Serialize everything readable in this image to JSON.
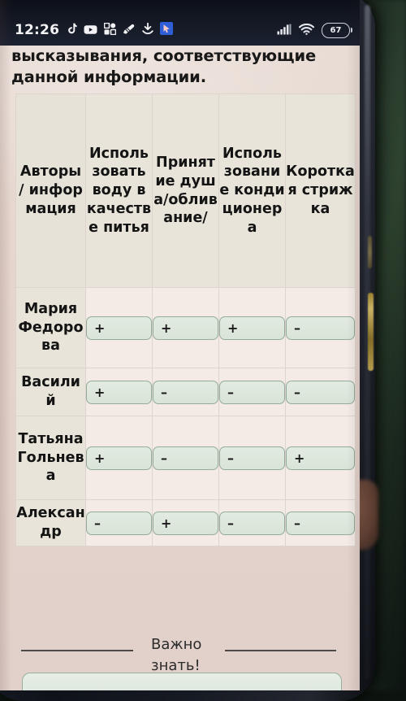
{
  "status_bar": {
    "time": "12:26",
    "left_icons": [
      "tiktok-icon",
      "youtube-icon",
      "qr-scanner-icon",
      "pen-tool-icon",
      "download-icon",
      "blue-app-icon"
    ],
    "right_icons": [
      "cellular-signal-icon",
      "wifi-icon"
    ],
    "battery_level": "67"
  },
  "content": {
    "intro_text": "высказывания, соответствующие данной информации.",
    "table": {
      "headers": [
        "Авторы / информация",
        "Использовать воду в качестве питья",
        "Принятие душа/обливание/",
        "Использование кондиционера",
        "Короткая стрижка"
      ],
      "rows": [
        {
          "name": "Мария Федорова",
          "values": [
            "+",
            "+",
            "+",
            "–"
          ]
        },
        {
          "name": "Василий",
          "values": [
            "+",
            "–",
            "–",
            "–"
          ]
        },
        {
          "name": "Татьяна Гольнева",
          "values": [
            "+",
            "–",
            "–",
            "+"
          ]
        },
        {
          "name": "Александр",
          "values": [
            "–",
            "+",
            "–",
            "–"
          ]
        }
      ]
    },
    "footer": {
      "note": "Важно знать!"
    }
  },
  "colors": {
    "page_background": "#e4d4cc",
    "table_cell": "#f4eae6",
    "header_cell": "#e8e4da",
    "mark_box_fill": "#dde7dc",
    "mark_box_border": "#93ab97",
    "status_bar": "#151a26"
  }
}
